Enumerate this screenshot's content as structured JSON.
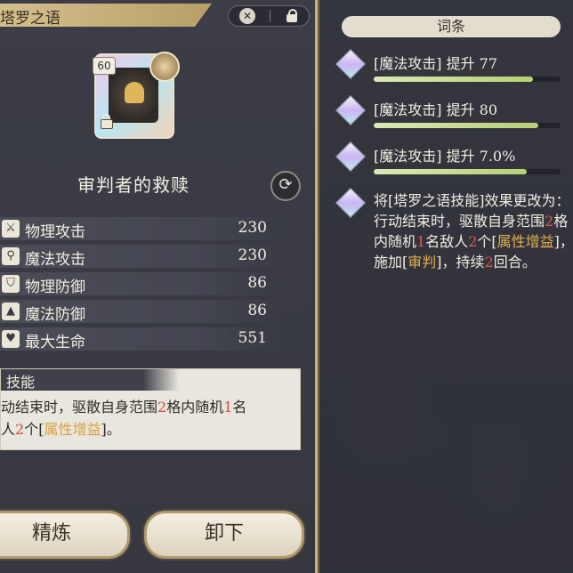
{
  "header": {
    "title": "塔罗之语"
  },
  "card": {
    "level": "60"
  },
  "item": {
    "name": "审判者的救赎"
  },
  "stats": [
    {
      "icon": "sword-icon",
      "label": "物理攻击",
      "value": "230"
    },
    {
      "icon": "wand-icon",
      "label": "魔法攻击",
      "value": "230"
    },
    {
      "icon": "shield-icon",
      "label": "物理防御",
      "value": "86"
    },
    {
      "icon": "wizard-hat-icon",
      "label": "魔法防御",
      "value": "86"
    },
    {
      "icon": "heart-icon",
      "label": "最大生命",
      "value": "551"
    }
  ],
  "skill": {
    "heading": "技能",
    "line1_a": "动结束时，驱散自身范围",
    "line1_n1": "2",
    "line1_b": "格内随机",
    "line1_n2": "1",
    "line1_c": "名",
    "line2_a": "人",
    "line2_n": "2",
    "line2_b": "个[",
    "line2_buff": "属性增益",
    "line2_c": "]。"
  },
  "buttons": {
    "refine": "精炼",
    "unequip": "卸下"
  },
  "affixes": {
    "title": "词条",
    "items": [
      {
        "text": "[魔法攻击] 提升 77",
        "progress": 0.85
      },
      {
        "text": "[魔法攻击] 提升 80",
        "progress": 0.88
      },
      {
        "text": "[魔法攻击] 提升 7.0%",
        "progress": 0.82
      }
    ],
    "desc": {
      "p1": "将[塔罗之语技能]效果更改为：行动结束时，驱散自身范围",
      "n1": "2",
      "p2": "格内随机",
      "n2": "1",
      "p3": "名敌人",
      "n3": "2",
      "p4": "个[",
      "buff": "属性增益",
      "p5": "]，施加[",
      "judg": "审判",
      "p6": "]，持续",
      "n4": "2",
      "p7": "回合。"
    }
  }
}
